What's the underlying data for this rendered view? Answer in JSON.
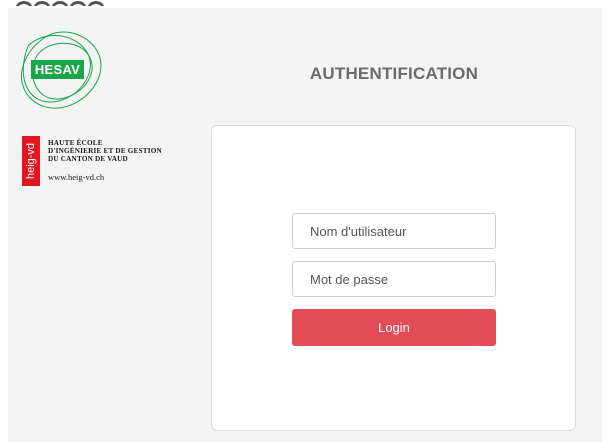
{
  "branding": {
    "hesav_logo_text": "HESAV",
    "hesav_color": "#1aa64a",
    "heig_logo_vertical": "heig-vd",
    "heig_lines": [
      "HAUTE ÉCOLE",
      "D'INGÉNIERIE ET DE GESTION",
      "DU CANTON DE VAUD"
    ],
    "heig_url": "www.heig-vd.ch",
    "heig_color": "#e3161f"
  },
  "header": {
    "title": "AUTHENTIFICATION"
  },
  "form": {
    "username_placeholder": "Nom d'utilisateur",
    "password_placeholder": "Mot de passe",
    "login_label": "Login",
    "login_color": "#e24c55"
  }
}
